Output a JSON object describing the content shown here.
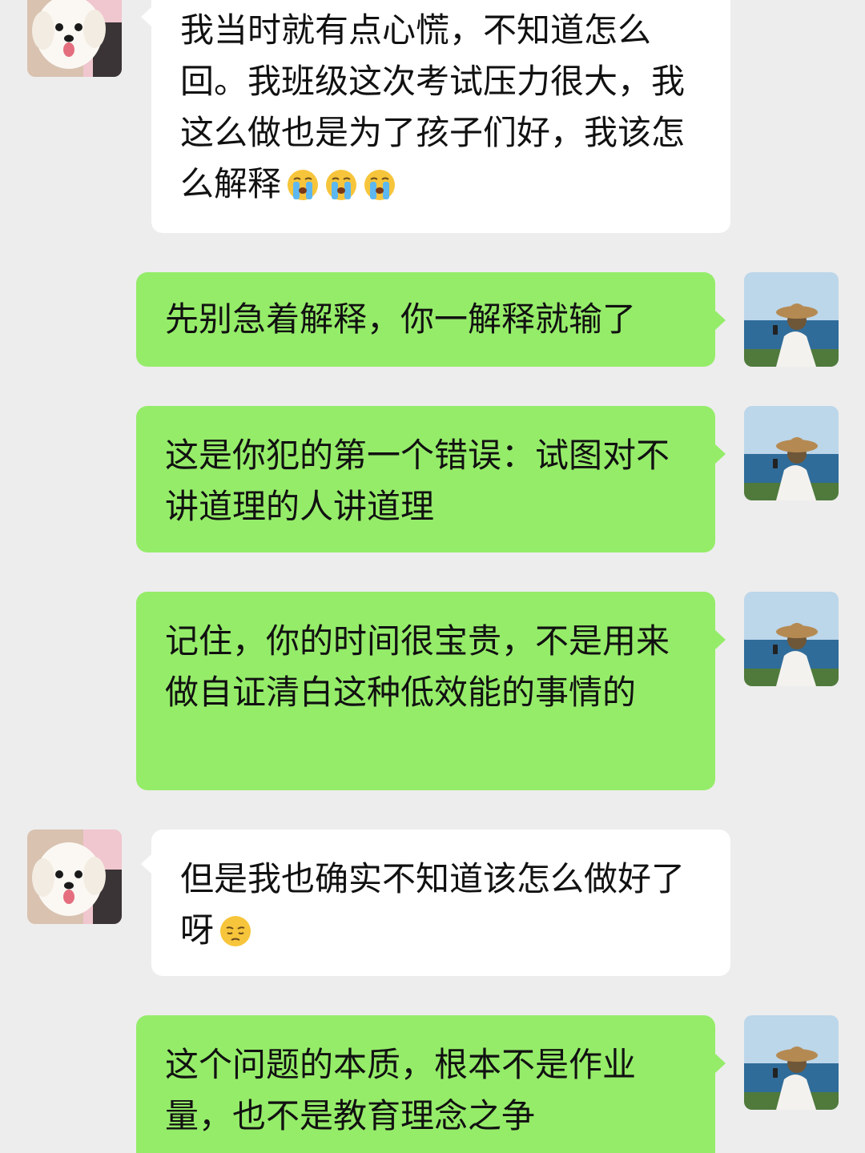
{
  "messages": [
    {
      "side": "incoming",
      "text": "我当时就有点心慌，不知道怎么回。我班级这次考试压力很大，我这么做也是为了孩子们好，我该怎么解释",
      "emoji": [
        "loudly-crying-face",
        "loudly-crying-face",
        "loudly-crying-face"
      ]
    },
    {
      "side": "outgoing",
      "text": "先别急着解释，你一解释就输了"
    },
    {
      "side": "outgoing",
      "text": "这是你犯的第一个错误：试图对不讲道理的人讲道理"
    },
    {
      "side": "outgoing",
      "text": "记住，你的时间很宝贵，不是用来做自证清白这种低效能的事情的"
    },
    {
      "side": "incoming",
      "text": "但是我也确实不知道该怎么做好了呀",
      "emoji": [
        "pensive-face"
      ]
    },
    {
      "side": "outgoing",
      "text": "这个问题的本质，根本不是作业量，也不是教育理念之争"
    }
  ],
  "colors": {
    "background": "#ededed",
    "incoming_bubble": "#ffffff",
    "outgoing_bubble": "#95ec69"
  }
}
